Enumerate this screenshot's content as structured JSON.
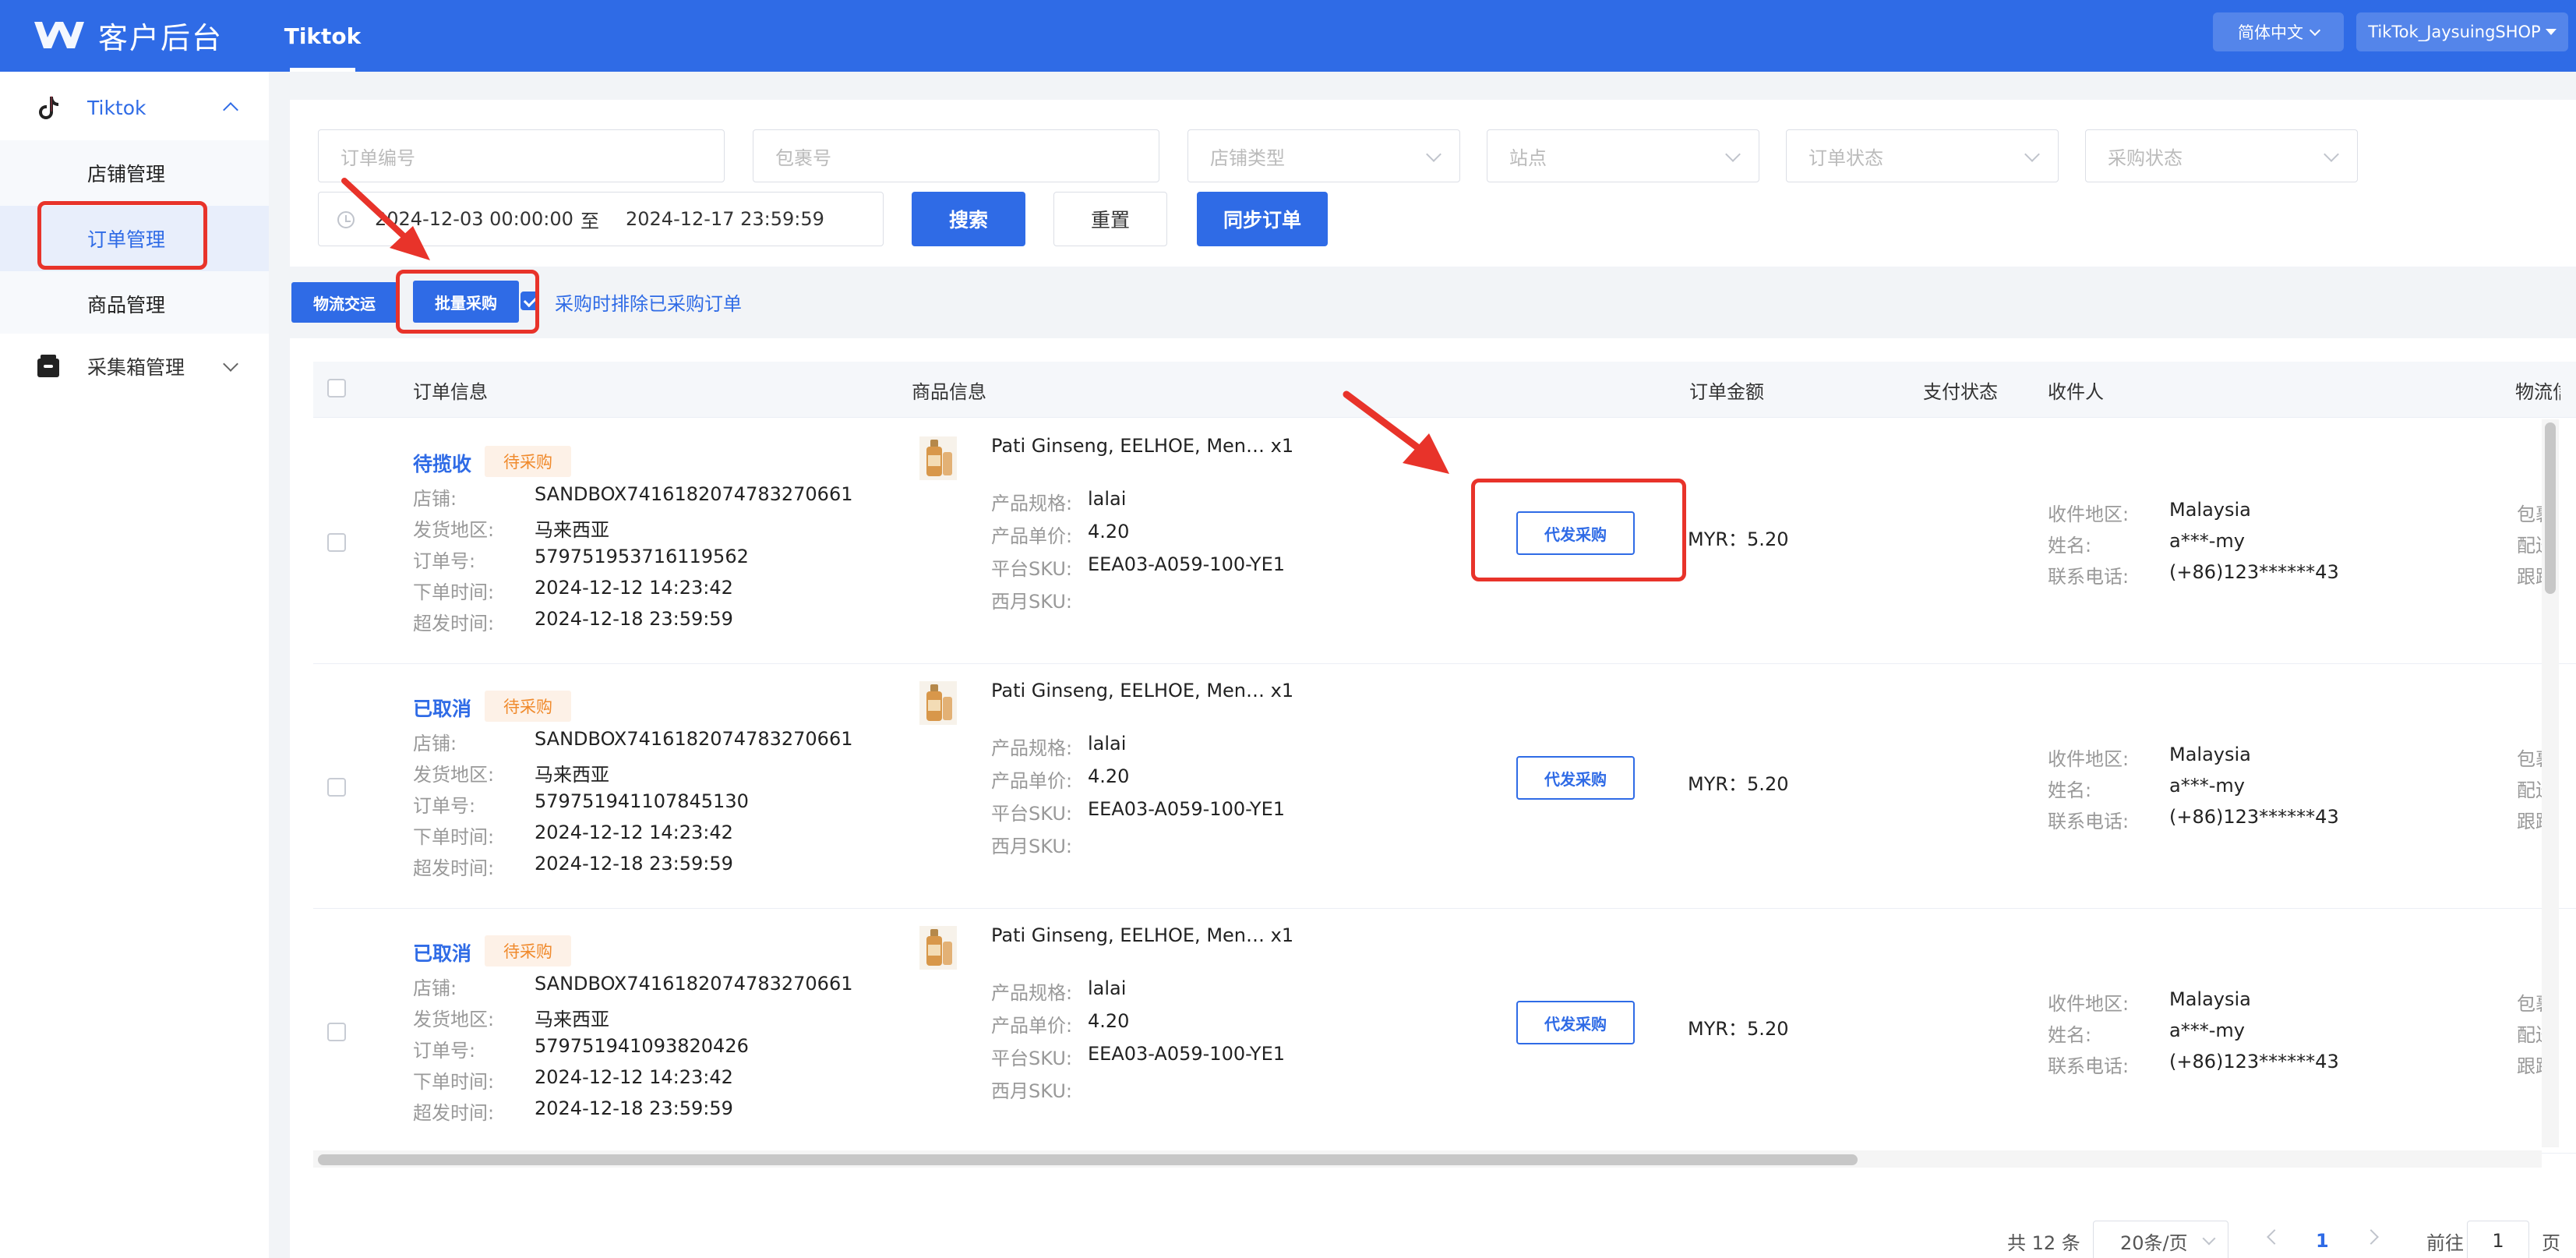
{
  "app": {
    "title": "客户后台",
    "top_tab": "Tiktok"
  },
  "header": {
    "language": "简体中文",
    "shop": "TikTok_JaysuingSHOP"
  },
  "sidebar": {
    "group_tiktok": "Tiktok",
    "items": [
      {
        "label": "店铺管理"
      },
      {
        "label": "订单管理"
      },
      {
        "label": "商品管理"
      }
    ],
    "group_collect": "采集箱管理"
  },
  "filters": {
    "order_no_placeholder": "订单编号",
    "package_no_placeholder": "包裹号",
    "shop_type_placeholder": "店铺类型",
    "site_placeholder": "站点",
    "order_status_placeholder": "订单状态",
    "purchase_status_placeholder": "采购状态",
    "date_start": "2024-12-03 00:00:00",
    "date_to": "至",
    "date_end": "2024-12-17 23:59:59",
    "search_label": "搜索",
    "reset_label": "重置",
    "sync_label": "同步订单"
  },
  "toolbar": {
    "logistics_label": "物流交运",
    "batch_purchase_label": "批量采购",
    "exclude_label": "采购时排除已采购订单"
  },
  "table": {
    "headers": {
      "order_info": "订单信息",
      "product_info": "商品信息",
      "amount": "订单金额",
      "pay_status": "支付状态",
      "receiver": "收件人",
      "logistics": "物流信"
    },
    "labels": {
      "shop": "店铺:",
      "ship_region": "发货地区:",
      "order_no": "订单号:",
      "order_time": "下单时间:",
      "deadline": "超发时间:",
      "spec": "产品规格:",
      "unit_price": "产品单价:",
      "platform_sku": "平台SKU:",
      "xiyue_sku": "西月SKU:",
      "recv_region": "收件地区:",
      "name": "姓名:",
      "phone": "联系电话:",
      "dropship_btn": "代发采购",
      "logi_1": "包裹",
      "logi_2": "配送",
      "logi_3": "跟踪"
    },
    "rows": [
      {
        "status": "待揽收",
        "purchase_tag": "待采购",
        "shop": "SANDBOX7416182074783270661",
        "ship_region": "马来西亚",
        "order_no": "579751953716119562",
        "order_time": "2024-12-12 14:23:42",
        "deadline": "2024-12-18 23:59:59",
        "product_title": "Pati Ginseng, EELHOE, Men… x1",
        "spec": "lalai",
        "unit_price": "4.20",
        "platform_sku": "EEA03-A059-100-YE1",
        "xiyue_sku": "",
        "amount": "MYR：5.20",
        "recv_region": "Malaysia",
        "name": "a***-my",
        "phone": "(+86)123******43"
      },
      {
        "status": "已取消",
        "purchase_tag": "待采购",
        "shop": "SANDBOX7416182074783270661",
        "ship_region": "马来西亚",
        "order_no": "579751941107845130",
        "order_time": "2024-12-12 14:23:42",
        "deadline": "2024-12-18 23:59:59",
        "product_title": "Pati Ginseng, EELHOE, Men… x1",
        "spec": "lalai",
        "unit_price": "4.20",
        "platform_sku": "EEA03-A059-100-YE1",
        "xiyue_sku": "",
        "amount": "MYR：5.20",
        "recv_region": "Malaysia",
        "name": "a***-my",
        "phone": "(+86)123******43"
      },
      {
        "status": "已取消",
        "purchase_tag": "待采购",
        "shop": "SANDBOX7416182074783270661",
        "ship_region": "马来西亚",
        "order_no": "579751941093820426",
        "order_time": "2024-12-12 14:23:42",
        "deadline": "2024-12-18 23:59:59",
        "product_title": "Pati Ginseng, EELHOE, Men… x1",
        "spec": "lalai",
        "unit_price": "4.20",
        "platform_sku": "EEA03-A059-100-YE1",
        "xiyue_sku": "",
        "amount": "MYR：5.20",
        "recv_region": "Malaysia",
        "name": "a***-my",
        "phone": "(+86)123******43"
      }
    ]
  },
  "pagination": {
    "total": "共 12 条",
    "page_size": "20条/页",
    "current_page": "1",
    "goto_label": "前往",
    "goto_value": "1",
    "page_suffix": "页"
  },
  "colors": {
    "primary": "#2f6be6",
    "annotation": "#e8332a",
    "tag_bg": "#fdf1e7",
    "tag_text": "#f08a2c"
  },
  "icons": [
    "logo-icon",
    "tiktok-icon",
    "collect-box-icon",
    "clock-icon",
    "chevron-down-icon",
    "chevron-up-icon",
    "product-thumbnail"
  ]
}
